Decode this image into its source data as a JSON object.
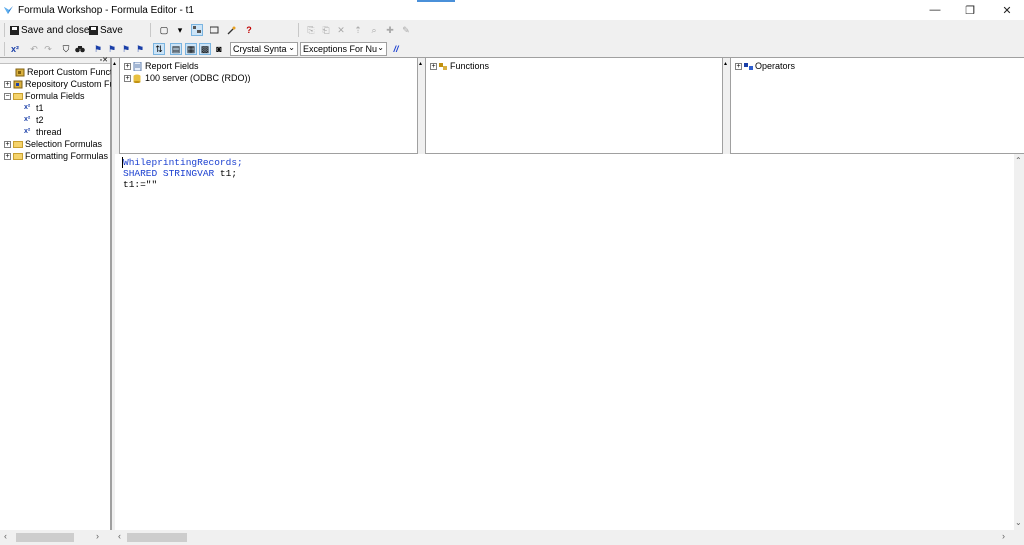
{
  "window": {
    "title": "Formula Workshop - Formula Editor - t1",
    "minimize": "—",
    "restore": "❐",
    "close": "✕"
  },
  "toolbar1": {
    "save_close_label": "Save and close",
    "save_label": "Save",
    "new_icon": "▢",
    "dropdown_icon": "▾",
    "help_icon": "?"
  },
  "toolbar2": {
    "syntax_combo": "Crystal Synta",
    "exceptions_combo": "Exceptions For Nu",
    "comment_icon": "//"
  },
  "tree": {
    "items": [
      {
        "label": "Report Custom Funct",
        "expander": ""
      },
      {
        "label": "Repository Custom Fu",
        "expander": "+"
      },
      {
        "label": "Formula Fields",
        "expander": "−"
      },
      {
        "label": "t1",
        "expander": ""
      },
      {
        "label": "t2",
        "expander": ""
      },
      {
        "label": "thread",
        "expander": ""
      },
      {
        "label": "Selection Formulas",
        "expander": "+"
      },
      {
        "label": "Formatting Formulas",
        "expander": "+"
      }
    ]
  },
  "fields_pane": {
    "items": [
      {
        "label": "Report Fields",
        "expander": "+"
      },
      {
        "label": "100 server (ODBC (RDO))",
        "expander": "+"
      }
    ]
  },
  "functions_pane": {
    "label": "Functions",
    "expander": "+"
  },
  "operators_pane": {
    "label": "Operators",
    "expander": "+"
  },
  "editor": {
    "lines": [
      {
        "text": "WhileprintingRecords;",
        "keyword": true
      },
      {
        "kw": "SHARED STRINGVAR",
        "rest": " t1;"
      },
      {
        "text": "t1:=\"\"",
        "keyword": false
      }
    ]
  },
  "colors": {
    "keyword": "#1a3fd0",
    "selection": "#cce4f7",
    "accent": "#4a90d9"
  }
}
